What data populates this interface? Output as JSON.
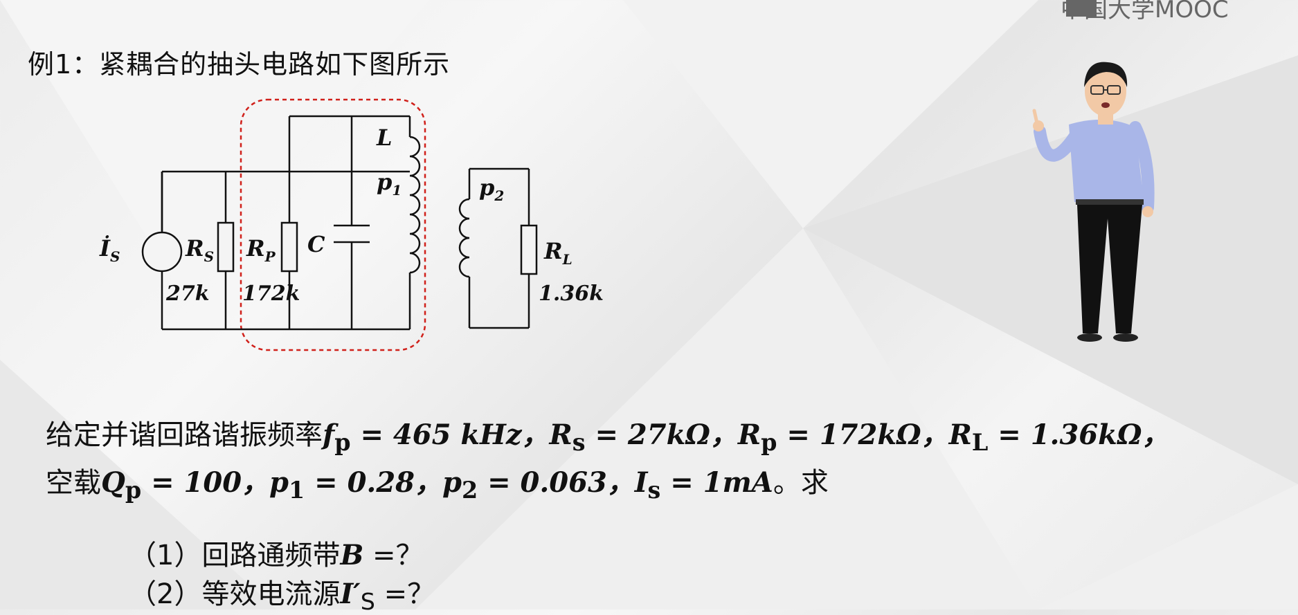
{
  "watermark": "中国大学MOOC",
  "title": "例1：紧耦合的抽头电路如下图所示",
  "circuit": {
    "source_label": "İ",
    "source_sub": "S",
    "rs_label": "R",
    "rs_sub": "S",
    "rs_value": "27k",
    "rp_label": "R",
    "rp_sub": "P",
    "rp_value": "172k",
    "c_label": "C",
    "l_label": "L",
    "p1_label": "p",
    "p1_sub": "1",
    "p2_label": "p",
    "p2_sub": "2",
    "rl_label": "R",
    "rl_sub": "L",
    "rl_value": "1.36k"
  },
  "given": {
    "line1_prefix": "给定并谐回路谐振频率",
    "line1_math": "f",
    "line1_math_sub": "p",
    "line1_rest": " =  465 kHz，R",
    "line1_rs_sub": "s",
    "line1_rest2": " =  27kΩ，R",
    "line1_rp_sub": "p",
    "line1_rest3": " = 172kΩ，R",
    "line1_rl_sub": "L",
    "line1_rest4": " = 1.36kΩ，",
    "line2_prefix": "空载",
    "line2_q": "Q",
    "line2_q_sub": "p",
    "line2_rest": " =  100，p",
    "line2_p1_sub": "1",
    "line2_rest2": " =  0.28，p",
    "line2_p2_sub": "2",
    "line2_rest3": " =  0.063，I",
    "line2_is_sub": "s",
    "line2_rest4": " =  1mA",
    "line2_end": "。求"
  },
  "questions": {
    "q1_num": "（1）",
    "q1_text": "回路通频带",
    "q1_var": "B",
    "q1_tail": " =？",
    "q2_num": "（2）",
    "q2_text": "等效电流源",
    "q2_var": "I′",
    "q2_var_sub": "S",
    "q2_tail": " =？"
  }
}
